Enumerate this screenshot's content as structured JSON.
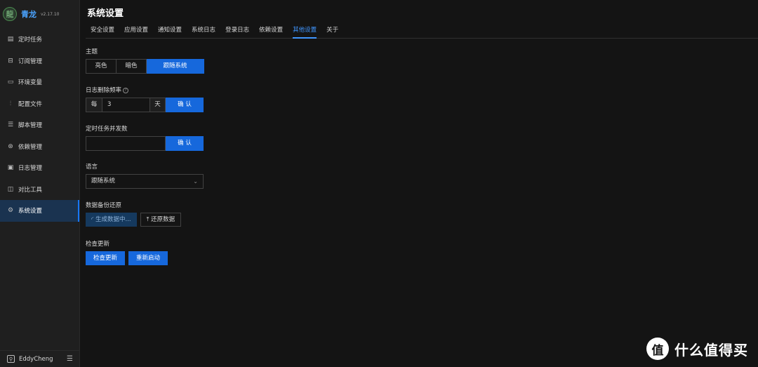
{
  "app": {
    "name": "青龙",
    "version": "v2.17.10",
    "logo_icon": "dragon-logo-icon"
  },
  "sidebar": {
    "items": [
      {
        "label": "定时任务",
        "icon": "schedule-icon"
      },
      {
        "label": "订阅管理",
        "icon": "subscription-icon"
      },
      {
        "label": "环境变量",
        "icon": "monitor-icon"
      },
      {
        "label": "配置文件",
        "icon": "config-icon"
      },
      {
        "label": "脚本管理",
        "icon": "script-icon"
      },
      {
        "label": "依赖管理",
        "icon": "dependency-icon"
      },
      {
        "label": "日志管理",
        "icon": "log-icon"
      },
      {
        "label": "对比工具",
        "icon": "diff-icon"
      },
      {
        "label": "系统设置",
        "icon": "gear-icon",
        "active": true
      }
    ],
    "user": "EddyCheng"
  },
  "page": {
    "title": "系统设置"
  },
  "tabs": [
    {
      "label": "安全设置"
    },
    {
      "label": "应用设置"
    },
    {
      "label": "通知设置"
    },
    {
      "label": "系统日志"
    },
    {
      "label": "登录日志"
    },
    {
      "label": "依赖设置"
    },
    {
      "label": "其他设置",
      "active": true
    },
    {
      "label": "关于"
    }
  ],
  "theme": {
    "label": "主题",
    "options": [
      "亮色",
      "暗色",
      "跟随系统"
    ],
    "selected": "跟随系统"
  },
  "log_cleanup": {
    "label": "日志删除频率",
    "prefix": "每",
    "value": "3",
    "suffix": "天",
    "confirm": "确 认"
  },
  "concurrency": {
    "label": "定时任务并发数",
    "value": "",
    "confirm": "确 认"
  },
  "language": {
    "label": "语言",
    "selected": "跟随系统"
  },
  "backup": {
    "label": "数据备份还原",
    "generate": "生成数据中...",
    "restore": "还原数据"
  },
  "update": {
    "label": "检查更新",
    "check": "检查更新",
    "restart": "重新启动"
  },
  "watermark": {
    "glyph": "值",
    "text": "什么值得买"
  },
  "colors": {
    "accent": "#1668dc",
    "active_tab": "#4096ff",
    "background": "#141414",
    "sidebar": "#1f1f1f"
  }
}
